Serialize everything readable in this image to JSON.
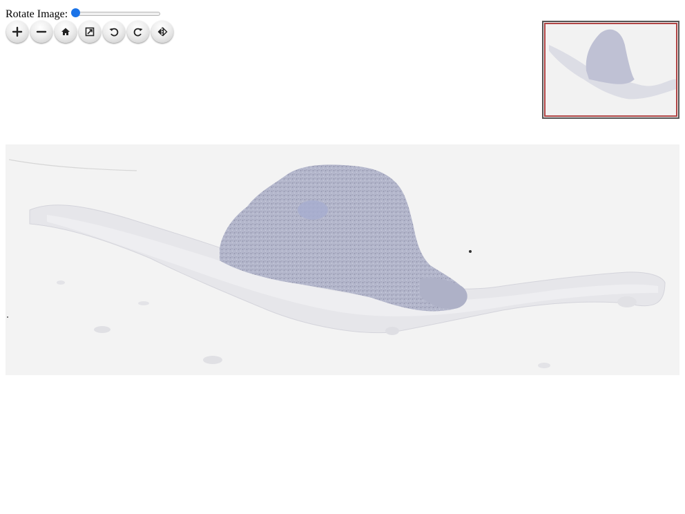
{
  "rotate": {
    "label": "Rotate Image:",
    "value": 0,
    "min": 0,
    "max": 360
  },
  "toolbar": {
    "buttons": [
      {
        "name": "zoom-in-button",
        "icon": "plus-icon"
      },
      {
        "name": "zoom-out-button",
        "icon": "minus-icon"
      },
      {
        "name": "home-button",
        "icon": "home-icon"
      },
      {
        "name": "fullscreen-button",
        "icon": "fullscreen-icon"
      },
      {
        "name": "rotate-left-button",
        "icon": "rotate-left-icon"
      },
      {
        "name": "rotate-right-button",
        "icon": "rotate-right-icon"
      },
      {
        "name": "flip-button",
        "icon": "flip-icon"
      }
    ]
  },
  "colors": {
    "slider_accent": "#1a73e8",
    "navigator_region": "#b04545",
    "tissue": "#b9bcd0",
    "background": "#f3f3f3"
  }
}
